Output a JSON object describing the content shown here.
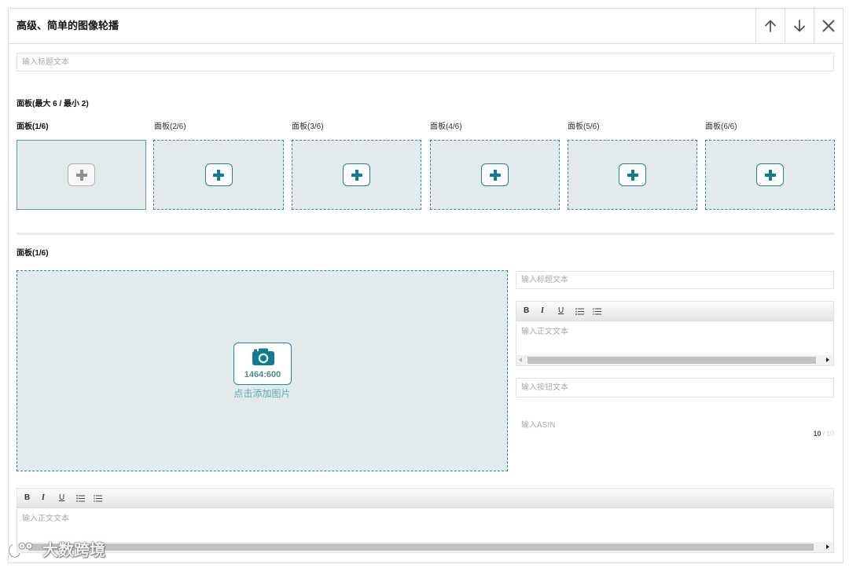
{
  "module": {
    "title": "高级、简单的图像轮播",
    "controls": {
      "move_up_icon": "arrow-up-icon",
      "move_down_icon": "arrow-down-icon",
      "remove_icon": "close-icon"
    }
  },
  "headline": {
    "placeholder": "输入标题文本"
  },
  "panels": {
    "section_label": "面板(最大 6 / 最小 2)",
    "add_icon": "plus-icon",
    "tabs": [
      {
        "label": "面板(1/6)",
        "selected": true
      },
      {
        "label": "面板(2/6)",
        "selected": false
      },
      {
        "label": "面板(3/6)",
        "selected": false
      },
      {
        "label": "面板(4/6)",
        "selected": false
      },
      {
        "label": "面板(5/6)",
        "selected": false
      },
      {
        "label": "面板(6/6)",
        "selected": false
      }
    ]
  },
  "active_panel": {
    "label": "面板(1/6)",
    "image": {
      "icon": "camera-icon",
      "ratio": "1464:600",
      "hint": "点击添加图片"
    },
    "headline": {
      "placeholder": "输入标题文本"
    },
    "body": {
      "placeholder": "输入正文文本",
      "toolbar": {
        "bold": "B",
        "italic": "I",
        "underline": "U",
        "bulleted_list_icon": "bulleted-list-icon",
        "numbered_list_icon": "numbered-list-icon"
      }
    },
    "button_text": {
      "placeholder": "输入按钮文本"
    },
    "asin": {
      "placeholder": "输入ASIN",
      "counter_current": "10",
      "counter_separator": "/",
      "counter_max": "10"
    }
  },
  "footer_body": {
    "placeholder": "输入正文文本",
    "toolbar": {
      "bold": "B",
      "italic": "I",
      "underline": "U",
      "bulleted_list_icon": "bulleted-list-icon",
      "numbered_list_icon": "numbered-list-icon"
    }
  },
  "watermark": {
    "logo": "watermark-logo",
    "text": "大数跨境"
  },
  "colors": {
    "accent": "#0e7d8d",
    "dashed_border": "#2b8ea0",
    "selected_border": "#4ea5b6",
    "panel_fill": "#e2eaeb",
    "placeholder": "#a9a9a9"
  }
}
